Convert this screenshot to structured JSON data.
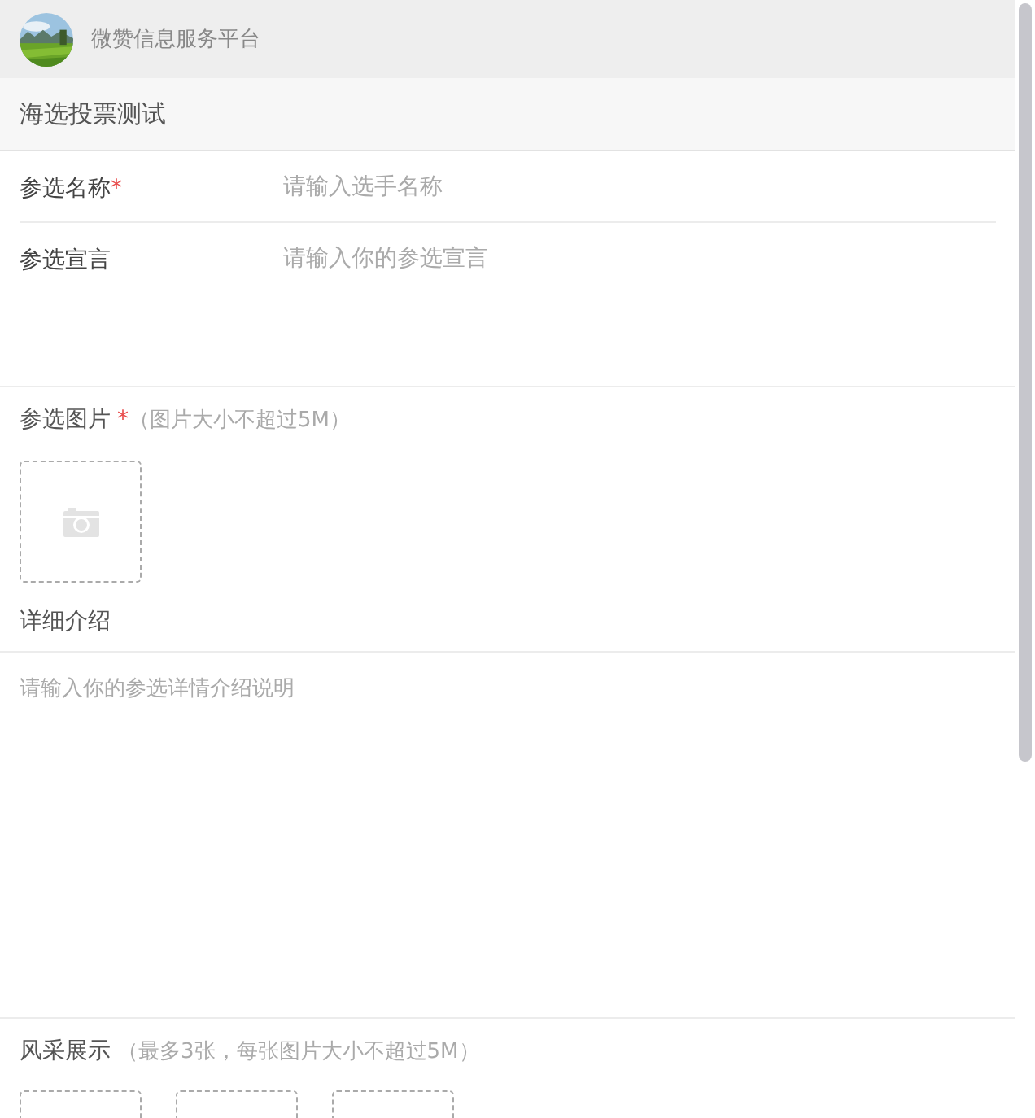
{
  "header": {
    "title": "微赞信息服务平台"
  },
  "page_title": "海选投票测试",
  "fields": [
    {
      "kind": "input",
      "label": "参选名称",
      "required_mark": "*",
      "placeholder": "请输入选手名称"
    },
    {
      "kind": "textarea",
      "label": "参选宣言",
      "placeholder": "请输入你的参选宣言"
    }
  ],
  "photo": {
    "label": "参选图片",
    "required_mark": "*",
    "hint": "（图片大小不超过5M）"
  },
  "intro": {
    "label": "详细介绍",
    "placeholder": "请输入你的参选详情介绍说明"
  },
  "gallery": {
    "label": "风采展示",
    "hint": "（最多3张，每张图片大小不超过5M）",
    "slots": [
      {
        "kind": "upload"
      },
      {
        "kind": "upload"
      },
      {
        "kind": "upload"
      }
    ]
  }
}
